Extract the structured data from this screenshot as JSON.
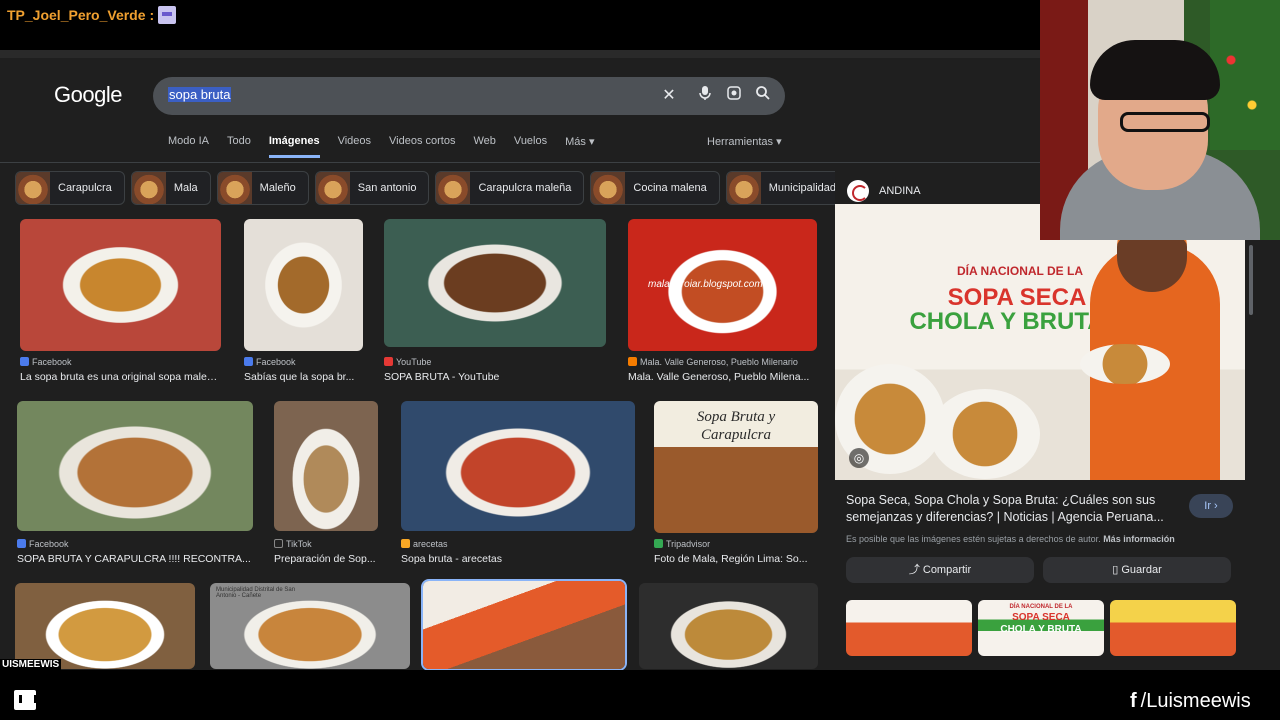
{
  "overlay": {
    "chat_user": "TP_Joel_Pero_Verde",
    "chat_sep": ":",
    "stream_handle": "UISMEEWIS",
    "social_handle": "/Luismeewis"
  },
  "google": {
    "logo": "Google",
    "query": "sopa bruta",
    "tabs": [
      {
        "label": "Modo IA"
      },
      {
        "label": "Todo"
      },
      {
        "label": "Imágenes"
      },
      {
        "label": "Videos"
      },
      {
        "label": "Videos cortos"
      },
      {
        "label": "Web"
      },
      {
        "label": "Vuelos"
      },
      {
        "label": "Más ▾"
      }
    ],
    "tools": "Herramientas ▾",
    "chips": [
      "Carapulcra",
      "Mala",
      "Maleño",
      "San antonio",
      "Carapulcra maleña",
      "Cocina malena",
      "Municipalidad di"
    ]
  },
  "results": [
    {
      "source": "Facebook",
      "title": "La sopa bruta es una original sopa maleñ...",
      "fav_color": "#4b7bec"
    },
    {
      "source": "Facebook",
      "title": "Sabías que la sopa br...",
      "fav_color": "#4b7bec"
    },
    {
      "source": "YouTube",
      "title": "SOPA BRUTA - YouTube",
      "fav_color": "#e53935"
    },
    {
      "source": "Mala. Valle Generoso, Pueblo Milenario",
      "title": "Mala. Valle Generoso, Pueblo Milena...",
      "fav_color": "#f57c00"
    },
    {
      "source": "Facebook",
      "title": "SOPA BRUTA Y CARAPULCRA !!!! RECONTRA...",
      "fav_color": "#4b7bec"
    },
    {
      "source": "TikTok",
      "title": "Preparación de Sop...",
      "fav_color": "#222222"
    },
    {
      "source": "arecetas",
      "title": "Sopa bruta - arecetas",
      "fav_color": "#f9a825"
    },
    {
      "source": "Tripadvisor",
      "title": "Foto de Mala, Región Lima: So...",
      "fav_color": "#34a853"
    }
  ],
  "image_texts": {
    "blog_watermark": "malaperoiar.blogspot.com",
    "card_title_1": "Sopa Bruta y",
    "card_title_2": "Carapulcra",
    "muni_caption": "Municipalidad Distrital de San Antonio - Cañete"
  },
  "panel": {
    "source": "ANDINA",
    "banner_line1": "DÍA NACIONAL DE LA",
    "banner_line2": "SOPA SECA",
    "banner_line3": "CHOLA Y BRUTA",
    "title": "Sopa Seca, Sopa Chola y Sopa Bruta: ¿Cuáles son sus semejanzas y diferencias? | Noticias | Agencia Peruana...",
    "go": "Ir ›",
    "note": "Es posible que las imágenes estén sujetas a derechos de autor.",
    "more_info": "Más información",
    "share": "Compartir",
    "save": "Guardar",
    "thumb_line1": "DÍA NACIONAL DE LA",
    "thumb_line2": "SOPA SECA",
    "thumb_line3": "CHOLA Y BRUTA"
  }
}
